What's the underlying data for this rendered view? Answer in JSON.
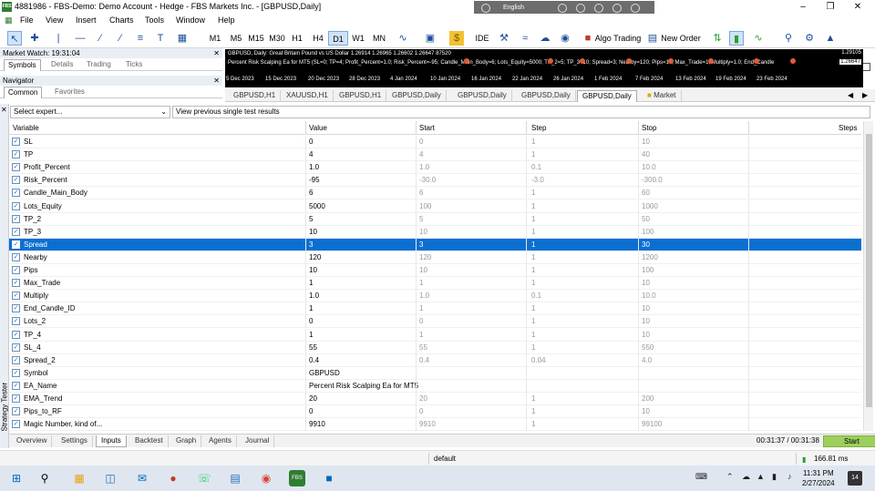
{
  "window": {
    "title": "4881986 - FBS-Demo: Demo Account - Hedge - FBS Markets Inc. - [GBPUSD,Daily]",
    "logo_text": "FBS"
  },
  "language_bar": {
    "label": "English"
  },
  "menu": [
    "File",
    "View",
    "Insert",
    "Charts",
    "Tools",
    "Window",
    "Help"
  ],
  "toolbar": {
    "timeframes": [
      "M1",
      "M5",
      "M15",
      "M30",
      "H1",
      "H4",
      "D1",
      "W1",
      "MN"
    ],
    "active_timeframe": "D1",
    "ide_label": "IDE",
    "algo_trading_label": "Algo Trading",
    "new_order_label": "New Order"
  },
  "market_watch": {
    "title": "Market Watch: 19:31:04",
    "tabs": [
      "Symbols",
      "Details",
      "Trading",
      "Ticks"
    ],
    "active_tab": "Symbols"
  },
  "navigator": {
    "title": "Navigator",
    "tabs": [
      "Common",
      "Favorites"
    ],
    "active_tab": "Common"
  },
  "chart": {
    "info": "GBPUSD, Daily: Great Britain Pound vs US Dollar 1.26914 1.26965 1.26602 1.26647 87520",
    "params": "Percent Risk Scalping Ea for MT5 (SL=0; TP=4; Profit_Percent=1.0; Risk_Percent=-95; Candle_Main_Body=6; Lots_Equity=5000; TP_2=5; TP_3=10; Spread=3; Nearby=120; Pips=10; Max_Trade=1; Multiply=1.0; End_Candle",
    "price_high": "1.29105",
    "price_low": "1.26647",
    "dates": [
      "5 Dec 2023",
      "15 Dec 2023",
      "20 Dec 2023",
      "28 Dec 2023",
      "4 Jan 2024",
      "10 Jan 2024",
      "16 Jan 2024",
      "22 Jan 2024",
      "26 Jan 2024",
      "1 Feb 2024",
      "7 Feb 2024",
      "13 Feb 2024",
      "19 Feb 2024",
      "23 Feb 2024"
    ]
  },
  "chart_tabs": [
    "GBPUSD,H1",
    "XAUUSD,H1",
    "GBPUSD,H1",
    "GBPUSD,Daily",
    "GBPUSD,Daily",
    "GBPUSD,Daily",
    "GBPUSD,Daily",
    "Market"
  ],
  "active_chart_tab": 6,
  "tester": {
    "side_label": "Strategy Tester",
    "select_expert": "Select expert...",
    "view_previous": "View previous single test results",
    "columns": {
      "variable": "Variable",
      "value": "Value",
      "start": "Start",
      "step": "Step",
      "stop": "Stop",
      "steps": "Steps"
    },
    "rows": [
      {
        "name": "SL",
        "value": "0",
        "start": "0",
        "step": "1",
        "stop": "10"
      },
      {
        "name": "TP",
        "value": "4",
        "start": "4",
        "step": "1",
        "stop": "40"
      },
      {
        "name": "Profit_Percent",
        "value": "1.0",
        "start": "1.0",
        "step": "0.1",
        "stop": "10.0"
      },
      {
        "name": "Risk_Percent",
        "value": "-95",
        "start": "-30.0",
        "step": "-3.0",
        "stop": "-300.0"
      },
      {
        "name": "Candle_Main_Body",
        "value": "6",
        "start": "6",
        "step": "1",
        "stop": "60"
      },
      {
        "name": "Lots_Equity",
        "value": "5000",
        "start": "100",
        "step": "1",
        "stop": "1000"
      },
      {
        "name": "TP_2",
        "value": "5",
        "start": "5",
        "step": "1",
        "stop": "50"
      },
      {
        "name": "TP_3",
        "value": "10",
        "start": "10",
        "step": "1",
        "stop": "100"
      },
      {
        "name": "Spread",
        "value": "3",
        "start": "3",
        "step": "1",
        "stop": "30"
      },
      {
        "name": "Nearby",
        "value": "120",
        "start": "120",
        "step": "1",
        "stop": "1200"
      },
      {
        "name": "Pips",
        "value": "10",
        "start": "10",
        "step": "1",
        "stop": "100"
      },
      {
        "name": "Max_Trade",
        "value": "1",
        "start": "1",
        "step": "1",
        "stop": "10"
      },
      {
        "name": "Multiply",
        "value": "1.0",
        "start": "1.0",
        "step": "0.1",
        "stop": "10.0"
      },
      {
        "name": "End_Candle_ID",
        "value": "1",
        "start": "1",
        "step": "1",
        "stop": "10"
      },
      {
        "name": "Lots_2",
        "value": "0",
        "start": "0",
        "step": "1",
        "stop": "10"
      },
      {
        "name": "TP_4",
        "value": "1",
        "start": "1",
        "step": "1",
        "stop": "10"
      },
      {
        "name": "SL_4",
        "value": "55",
        "start": "55",
        "step": "1",
        "stop": "550"
      },
      {
        "name": "Spread_2",
        "value": "0.4",
        "start": "0.4",
        "step": "0.04",
        "stop": "4.0"
      },
      {
        "name": "Symbol",
        "value": "GBPUSD",
        "start": "",
        "step": "",
        "stop": ""
      },
      {
        "name": "EA_Name",
        "value": "Percent Risk Scalping Ea for MT5",
        "start": "",
        "step": "",
        "stop": ""
      },
      {
        "name": "EMA_Trend",
        "value": "20",
        "start": "20",
        "step": "1",
        "stop": "200"
      },
      {
        "name": "Pips_to_RF",
        "value": "0",
        "start": "0",
        "step": "1",
        "stop": "10"
      },
      {
        "name": "Magic Number, kind of...",
        "value": "9910",
        "start": "9910",
        "step": "1",
        "stop": "99100"
      }
    ],
    "selected_row": 8,
    "bottom_tabs": [
      "Overview",
      "Settings",
      "Inputs",
      "Backtest",
      "Graph",
      "Agents",
      "Journal"
    ],
    "active_bottom_tab": "Inputs",
    "timer": "00:31:37 / 00:31:38",
    "start_label": "Start"
  },
  "status": {
    "profile": "default",
    "ping": "166.81 ms"
  },
  "taskbar": {
    "time": "11:31 PM",
    "date": "2/27/2024",
    "notifications": "14"
  }
}
